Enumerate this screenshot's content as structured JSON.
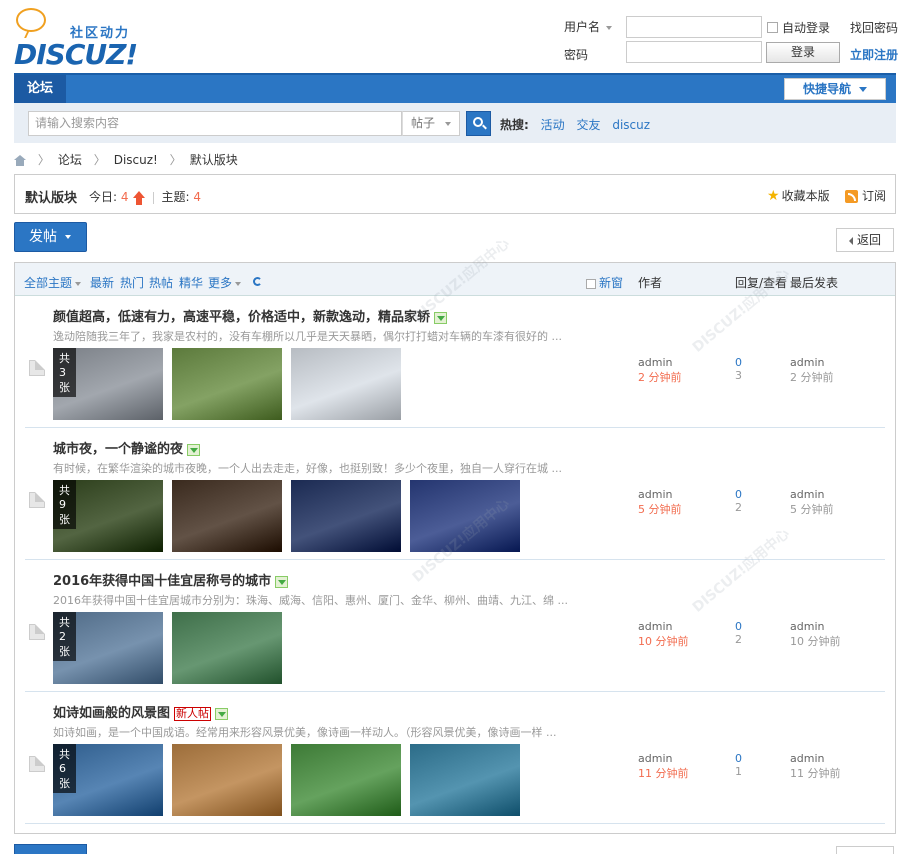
{
  "header": {
    "logo_cn": "社区动力",
    "logo_en": "DISCUZ!",
    "login": {
      "username_label": "用户名",
      "password_label": "密码",
      "auto_login": "自动登录",
      "login_button": "登录",
      "find_password": "找回密码",
      "register": "立即注册"
    }
  },
  "nav": {
    "forum_tab": "论坛",
    "quick_nav": "快捷导航"
  },
  "search": {
    "placeholder": "请输入搜索内容",
    "type": "帖子",
    "hot_label": "热搜:",
    "hot_terms": [
      "活动",
      "交友",
      "discuz"
    ]
  },
  "breadcrumb": [
    "论坛",
    "Discuz!",
    "默认版块"
  ],
  "forum": {
    "name": "默认版块",
    "today_label": "今日:",
    "today_count": "4",
    "topic_label": "主题:",
    "topic_count": "4",
    "favorite": "收藏本版",
    "subscribe": "订阅"
  },
  "actions": {
    "post": "发帖",
    "back": "返回"
  },
  "filters": {
    "all": "全部主题",
    "latest": "最新",
    "hot": "热门",
    "hotpost": "热帖",
    "digest": "精华",
    "more": "更多",
    "new_window": "新窗",
    "author": "作者",
    "reply_view": "回复/查看",
    "last_post": "最后发表"
  },
  "threads": [
    {
      "title": "颜值超高，低速有力，高速平稳，价格适中，新款逸动，精品家轿",
      "summary": "逸动陪随我三年了，我家是农村的，没有车棚所以几乎是天天暴晒，偶尔打打蜡对车辆的车漆有很好的 ...",
      "count": "共3张",
      "author": "admin",
      "time": "2 分钟前",
      "replies": "0",
      "views": "3",
      "last_author": "admin",
      "last_time": "2 分钟前",
      "new": false,
      "pics": [
        "#7a7f86",
        "#5c7a3c",
        "#b7bcc2"
      ]
    },
    {
      "title": "城市夜，一个静谧的夜",
      "summary": "有时候，在繁华渲染的城市夜晚，一个人出去走走，好像，也挺别致！多少个夜里，独自一人穿行在城 ...",
      "count": "共9张",
      "author": "admin",
      "time": "5 分钟前",
      "replies": "0",
      "views": "2",
      "last_author": "admin",
      "last_time": "5 分钟前",
      "new": false,
      "pics": [
        "#2b3d1a",
        "#3a2a1e",
        "#1b2a52",
        "#24356f"
      ]
    },
    {
      "title": "2016年获得中国十佳宜居称号的城市",
      "summary": "2016年获得中国十佳宜居城市分别为：珠海、威海、信阳、惠州、厦门、金华、柳州、曲靖、九江、绵 ...",
      "count": "共2张",
      "author": "admin",
      "time": "10 分钟前",
      "replies": "0",
      "views": "2",
      "last_author": "admin",
      "last_time": "10 分钟前",
      "new": false,
      "pics": [
        "#4f6a86",
        "#3f6f4a"
      ]
    },
    {
      "title": "如诗如画般的风景图",
      "summary": "如诗如画，是一个中国成语。经常用来形容风景优美，像诗画一样动人。（形容风景优美，像诗画一样 ...",
      "count": "共6张",
      "author": "admin",
      "time": "11 分钟前",
      "replies": "0",
      "views": "1",
      "last_author": "admin",
      "last_time": "11 分钟前",
      "new": true,
      "new_label": "新人帖",
      "pics": [
        "#2f5d8c",
        "#9c6d3a",
        "#3d7a36",
        "#2c6c88"
      ]
    }
  ],
  "colors": {
    "brand_blue": "#2b76c4",
    "accent_orange": "#f26c4f"
  }
}
